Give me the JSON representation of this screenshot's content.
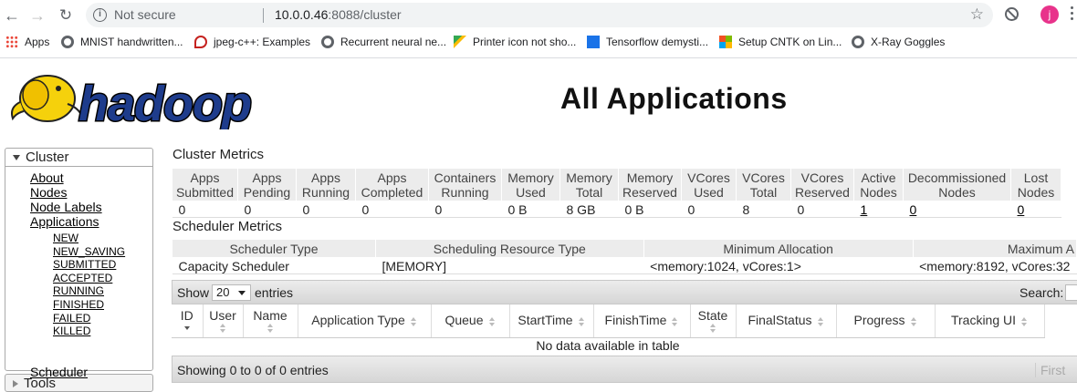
{
  "browser": {
    "security_label": "Not secure",
    "url_host": "10.0.0.46",
    "url_path": ":8088/cluster",
    "avatar_letter": "j",
    "bookmarks": [
      {
        "label": "Apps",
        "icon": "apps-grid-icon"
      },
      {
        "label": "MNIST handwritten...",
        "icon": "globe-icon"
      },
      {
        "label": "jpeg-c++: Examples",
        "icon": "spiral-icon"
      },
      {
        "label": "Recurrent neural ne...",
        "icon": "globe-icon"
      },
      {
        "label": "Printer icon not sho...",
        "icon": "triangle-icon"
      },
      {
        "label": "Tensorflow demysti...",
        "icon": "tensorflow-icon"
      },
      {
        "label": "Setup CNTK on Lin...",
        "icon": "microsoft-icon"
      },
      {
        "label": "X-Ray Goggles",
        "icon": "globe-icon"
      }
    ]
  },
  "header": {
    "logo_text": "hadoop",
    "title": "All Applications"
  },
  "sidebar": {
    "cluster_label": "Cluster",
    "links": [
      "About",
      "Nodes",
      "Node Labels",
      "Applications"
    ],
    "app_states": [
      "NEW",
      "NEW_SAVING",
      "SUBMITTED",
      "ACCEPTED",
      "RUNNING",
      "FINISHED",
      "FAILED",
      "KILLED"
    ],
    "scheduler_label": "Scheduler",
    "tools_label": "Tools"
  },
  "cluster_metrics": {
    "title": "Cluster Metrics",
    "headers": [
      [
        "Apps",
        "Submitted"
      ],
      [
        "Apps",
        "Pending"
      ],
      [
        "Apps",
        "Running"
      ],
      [
        "Apps",
        "Completed"
      ],
      [
        "Containers",
        "Running"
      ],
      [
        "Memory",
        "Used"
      ],
      [
        "Memory",
        "Total"
      ],
      [
        "Memory",
        "Reserved"
      ],
      [
        "VCores",
        "Used"
      ],
      [
        "VCores",
        "Total"
      ],
      [
        "VCores",
        "Reserved"
      ],
      [
        "Active",
        "Nodes"
      ],
      [
        "Decommissioned",
        "Nodes"
      ],
      [
        "Lost",
        "Nodes"
      ]
    ],
    "values": [
      "0",
      "0",
      "0",
      "0",
      "0",
      "0 B",
      "8 GB",
      "0 B",
      "0",
      "8",
      "0",
      "1",
      "0",
      "0"
    ]
  },
  "scheduler_metrics": {
    "title": "Scheduler Metrics",
    "headers": [
      "Scheduler Type",
      "Scheduling Resource Type",
      "Minimum Allocation",
      "Maximum A"
    ],
    "values": [
      "Capacity Scheduler",
      "[MEMORY]",
      "<memory:1024, vCores:1>",
      "<memory:8192, vCores:32"
    ]
  },
  "apps_table": {
    "show_label": "Show",
    "page_size": "20",
    "entries_label": "entries",
    "search_label": "Search:",
    "columns": [
      "ID",
      "User",
      "Name",
      "Application Type",
      "Queue",
      "StartTime",
      "FinishTime",
      "State",
      "FinalStatus",
      "Progress",
      "Tracking UI"
    ],
    "empty_message": "No data available in table",
    "info": "Showing 0 to 0 of 0 entries",
    "first_label": "First"
  }
}
